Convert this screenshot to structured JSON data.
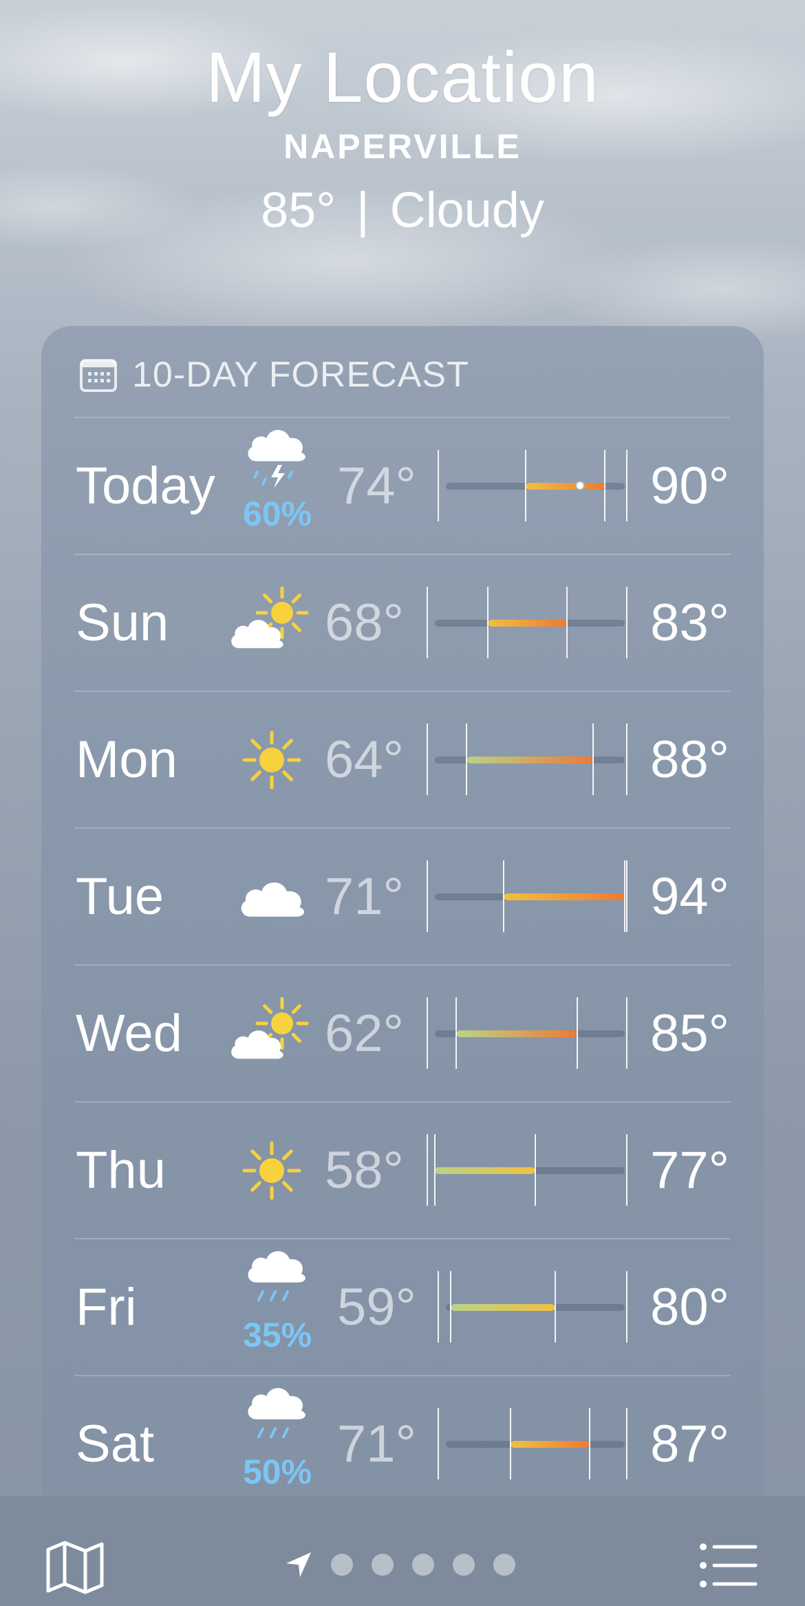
{
  "location": {
    "title": "My Location",
    "city": "NAPERVILLE",
    "temp": "85°",
    "separator": "|",
    "condition": "Cloudy"
  },
  "forecast": {
    "header": "10-DAY FORECAST",
    "header_icon": "calendar-icon",
    "range_min": 58,
    "range_max": 94,
    "current_temp": 85,
    "days": [
      {
        "day": "Today",
        "icon": "thunderstorm-icon",
        "precip": "60%",
        "low": "74°",
        "high": "90°",
        "low_val": 74,
        "high_val": 90,
        "now": true
      },
      {
        "day": "Sun",
        "icon": "partly-sunny-icon",
        "precip": "",
        "low": "68°",
        "high": "83°",
        "low_val": 68,
        "high_val": 83,
        "now": false
      },
      {
        "day": "Mon",
        "icon": "sun-icon",
        "precip": "",
        "low": "64°",
        "high": "88°",
        "low_val": 64,
        "high_val": 88,
        "now": false
      },
      {
        "day": "Tue",
        "icon": "cloud-icon",
        "precip": "",
        "low": "71°",
        "high": "94°",
        "low_val": 71,
        "high_val": 94,
        "now": false
      },
      {
        "day": "Wed",
        "icon": "partly-sunny-icon",
        "precip": "",
        "low": "62°",
        "high": "85°",
        "low_val": 62,
        "high_val": 85,
        "now": false
      },
      {
        "day": "Thu",
        "icon": "sun-icon",
        "precip": "",
        "low": "58°",
        "high": "77°",
        "low_val": 58,
        "high_val": 77,
        "now": false
      },
      {
        "day": "Fri",
        "icon": "rain-icon",
        "precip": "35%",
        "low": "59°",
        "high": "80°",
        "low_val": 59,
        "high_val": 80,
        "now": false
      },
      {
        "day": "Sat",
        "icon": "rain-icon",
        "precip": "50%",
        "low": "71°",
        "high": "87°",
        "low_val": 71,
        "high_val": 87,
        "now": false
      }
    ]
  },
  "tabbar": {
    "map_icon": "map-icon",
    "location_icon": "location-arrow-icon",
    "page_count": 5,
    "list_icon": "list-icon"
  },
  "colors": {
    "precip": "#7cc6f4",
    "sun": "#f7d23e",
    "cool": "#b9d38a",
    "warm": "#f0c040",
    "hot": "#ee7a35"
  }
}
